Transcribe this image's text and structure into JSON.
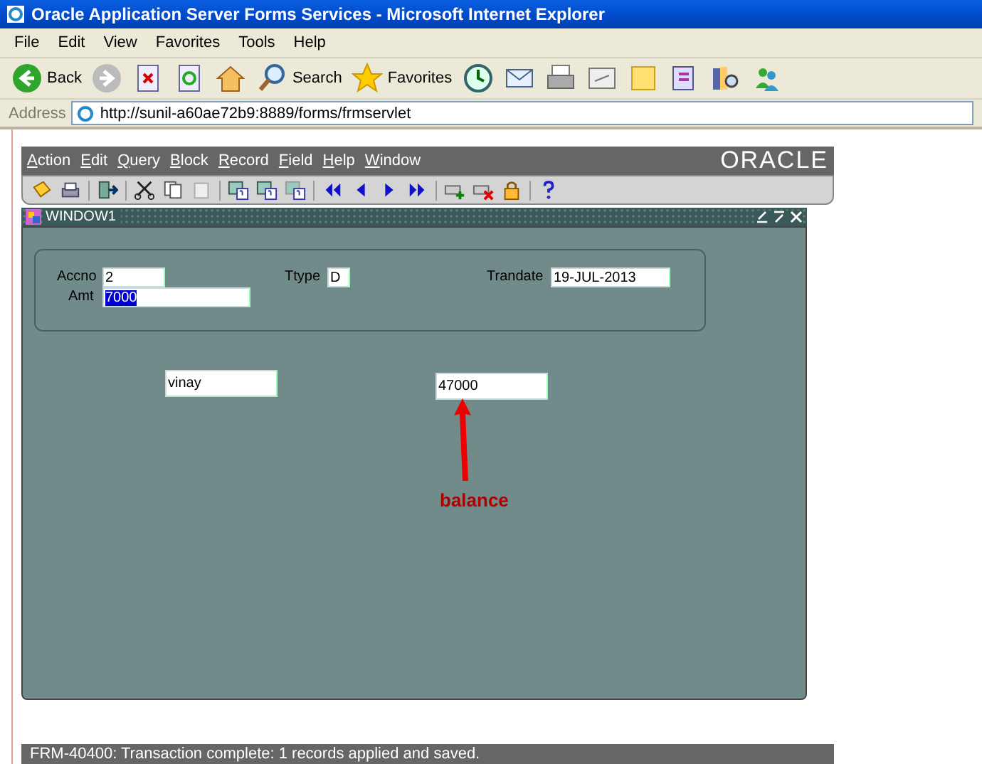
{
  "browser": {
    "title": "Oracle Application Server Forms Services - Microsoft Internet Explorer",
    "menu": [
      "File",
      "Edit",
      "View",
      "Favorites",
      "Tools",
      "Help"
    ],
    "toolbar": [
      {
        "kind": "back",
        "label": "Back"
      },
      {
        "kind": "forward"
      },
      {
        "kind": "stop"
      },
      {
        "kind": "refresh"
      },
      {
        "kind": "home"
      },
      {
        "kind": "search",
        "label": "Search"
      },
      {
        "kind": "favorites",
        "label": "Favorites"
      },
      {
        "kind": "history"
      },
      {
        "kind": "mail"
      },
      {
        "kind": "print"
      },
      {
        "kind": "edit"
      },
      {
        "kind": "note"
      },
      {
        "kind": "messenger"
      },
      {
        "kind": "research"
      },
      {
        "kind": "contacts"
      }
    ],
    "address": {
      "label": "Address",
      "url": "http://sunil-a60ae72b9:8889/forms/frmservlet"
    }
  },
  "forms": {
    "menu": [
      "Action",
      "Edit",
      "Query",
      "Block",
      "Record",
      "Field",
      "Help",
      "Window"
    ],
    "logo": "ORACLE",
    "toolbar": [
      {
        "kind": "save"
      },
      {
        "kind": "print"
      },
      {
        "kind": "sep"
      },
      {
        "kind": "exit"
      },
      {
        "kind": "sep"
      },
      {
        "kind": "cut"
      },
      {
        "kind": "copy"
      },
      {
        "kind": "paste"
      },
      {
        "kind": "sep"
      },
      {
        "kind": "query-enter"
      },
      {
        "kind": "query-run"
      },
      {
        "kind": "query-cancel"
      },
      {
        "kind": "sep"
      },
      {
        "kind": "first"
      },
      {
        "kind": "prev"
      },
      {
        "kind": "next"
      },
      {
        "kind": "last"
      },
      {
        "kind": "sep"
      },
      {
        "kind": "insert"
      },
      {
        "kind": "delete"
      },
      {
        "kind": "lock"
      },
      {
        "kind": "sep"
      },
      {
        "kind": "help"
      }
    ],
    "window": {
      "title": "WINDOW1",
      "fields": [
        {
          "label": "Accno",
          "value": "2",
          "selected": false
        },
        {
          "label": "Ttype",
          "value": "D",
          "selected": false
        },
        {
          "label": "Trandate",
          "value": "19-JUL-2013",
          "selected": false
        },
        {
          "label": "Amt",
          "value": "7000",
          "selected": true
        },
        {
          "value": "vinay",
          "selected": false
        },
        {
          "value": "47000",
          "selected": false
        }
      ],
      "annotation": "balance"
    },
    "status": "FRM-40400: Transaction complete: 1 records applied and saved."
  }
}
